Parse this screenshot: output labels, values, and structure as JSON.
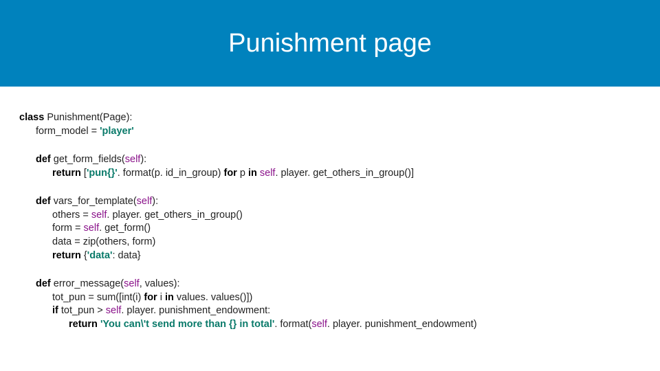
{
  "title": "Punishment page",
  "code": {
    "l1_a": "class",
    "l1_b": " Punishment(Page):",
    "l2_a": "form_model = ",
    "l2_b": "'player'",
    "l3_a": "def",
    "l3_b": " get_form_fields(",
    "l3_c": "self",
    "l3_d": "):",
    "l4_a": "return",
    "l4_b": " [",
    "l4_c": "'pun{}'",
    "l4_d": ". format(p. id_in_group) ",
    "l4_e": "for",
    "l4_f": " p ",
    "l4_g": "in",
    "l4_h": " ",
    "l4_i": "self",
    "l4_j": ". player. get_others_in_group()]",
    "l5_a": "def",
    "l5_b": " vars_for_template(",
    "l5_c": "self",
    "l5_d": "):",
    "l6_a": "others = ",
    "l6_b": "self",
    "l6_c": ". player. get_others_in_group()",
    "l7_a": "form = ",
    "l7_b": "self",
    "l7_c": ". get_form()",
    "l8": "data = zip(others, form)",
    "l9_a": "return",
    "l9_b": " {",
    "l9_c": "'data'",
    "l9_d": ": data}",
    "l10_a": "def",
    "l10_b": " error_message(",
    "l10_c": "self",
    "l10_d": ", values):",
    "l11_a": "tot_pun = sum([int(i) ",
    "l11_b": "for",
    "l11_c": " i ",
    "l11_d": "in",
    "l11_e": " values. values()])",
    "l12_a": "if",
    "l12_b": " tot_pun > ",
    "l12_c": "self",
    "l12_d": ". player. punishment_endowment:",
    "l13_a": "return",
    "l13_b": " ",
    "l13_c": "'You can\\'t send more than {} in total'",
    "l13_d": ". format(",
    "l13_e": "self",
    "l13_f": ". player. punishment_endowment)"
  }
}
